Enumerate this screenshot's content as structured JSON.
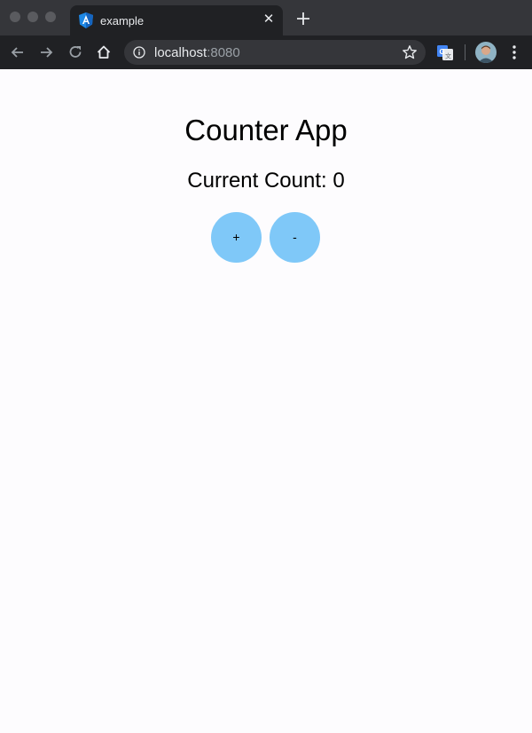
{
  "browser": {
    "tab": {
      "title": "example",
      "favicon": "angular-logo-icon"
    },
    "address": {
      "host": "localhost",
      "port": ":8080"
    },
    "colors": {
      "titlebar": "#35363a",
      "toolbar": "#202124"
    }
  },
  "app": {
    "title": "Counter App",
    "count_label": "Current Count:",
    "count_value": "0",
    "buttons": {
      "increment_label": "+",
      "decrement_label": "-"
    },
    "colors": {
      "button": "#7fc8f8",
      "background": "#fdfcfe"
    }
  }
}
